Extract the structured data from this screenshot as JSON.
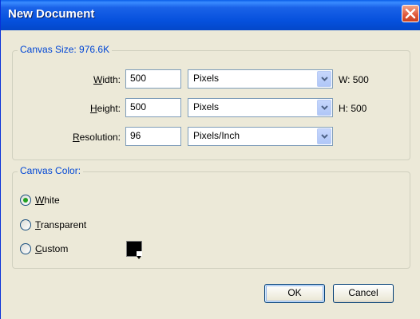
{
  "window": {
    "title": "New Document",
    "close_icon": "close-icon"
  },
  "canvas_size": {
    "legend": "Canvas Size: 976.6K",
    "width": {
      "label_pre": "",
      "label_key": "W",
      "label_post": "idth:",
      "value": "500",
      "unit": "Pixels",
      "dimension": "W: 500"
    },
    "height": {
      "label_pre": "",
      "label_key": "H",
      "label_post": "eight:",
      "value": "500",
      "unit": "Pixels",
      "dimension": "H: 500"
    },
    "resolution": {
      "label_pre": "",
      "label_key": "R",
      "label_post": "esolution:",
      "value": "96",
      "unit": "Pixels/Inch"
    }
  },
  "canvas_color": {
    "legend": "Canvas Color:",
    "options": [
      {
        "key": "W",
        "rest": "hite",
        "selected": true
      },
      {
        "key": "T",
        "rest": "ransparent",
        "selected": false
      },
      {
        "key": "C",
        "rest": "ustom",
        "selected": false
      }
    ],
    "custom_swatch_color": "#000000"
  },
  "buttons": {
    "ok": "OK",
    "cancel": "Cancel"
  },
  "colors": {
    "titlebar": "#0550dc",
    "legend_text": "#0046d5",
    "dialog_bg": "#ece9d8",
    "radio_dot": "#21a121"
  }
}
